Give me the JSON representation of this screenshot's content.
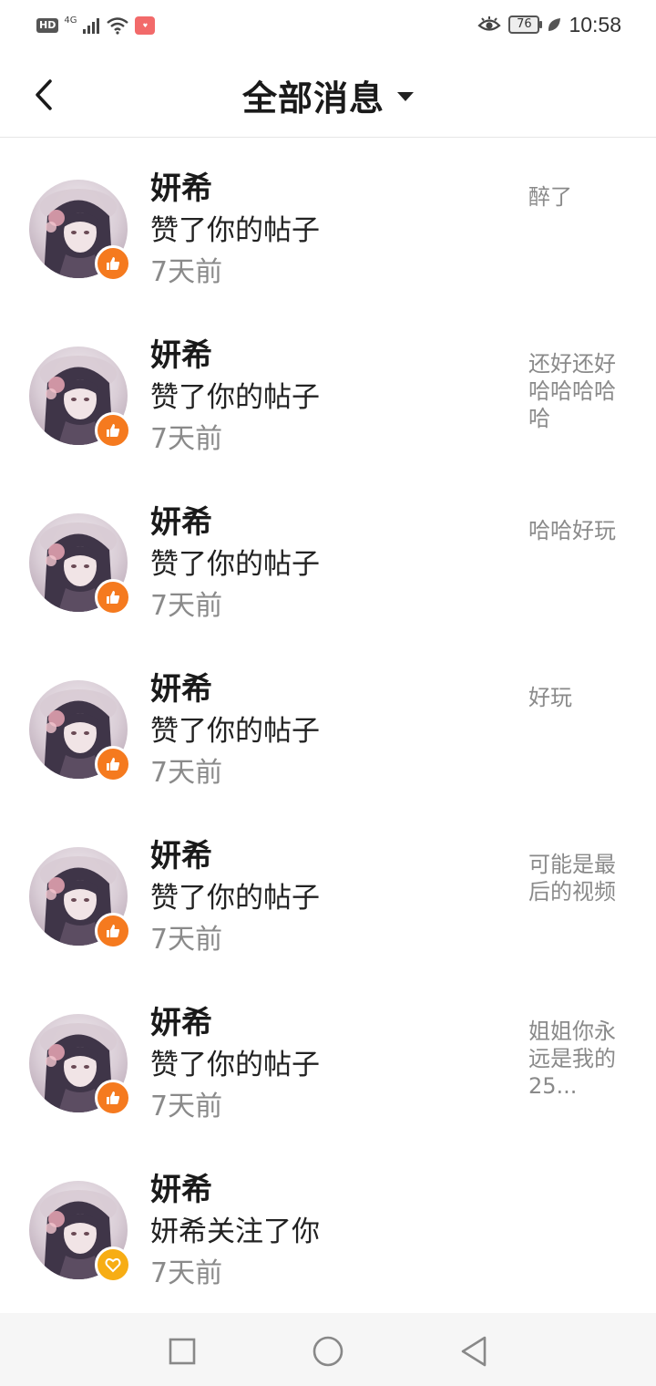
{
  "status_bar": {
    "hd": "HD",
    "network": "4G",
    "battery": "76",
    "time": "10:58"
  },
  "header": {
    "title": "全部消息"
  },
  "messages": [
    {
      "name": "妍希",
      "action": "赞了你的帖子",
      "time": "7天前",
      "snippet": "醉了",
      "badge": "thumb-up-icon"
    },
    {
      "name": "妍希",
      "action": "赞了你的帖子",
      "time": "7天前",
      "snippet": "还好还好哈哈哈哈哈",
      "badge": "thumb-up-icon"
    },
    {
      "name": "妍希",
      "action": "赞了你的帖子",
      "time": "7天前",
      "snippet": "哈哈好玩",
      "badge": "thumb-up-icon"
    },
    {
      "name": "妍希",
      "action": "赞了你的帖子",
      "time": "7天前",
      "snippet": "好玩",
      "badge": "thumb-up-icon"
    },
    {
      "name": "妍希",
      "action": "赞了你的帖子",
      "time": "7天前",
      "snippet": "可能是最后的视频",
      "badge": "thumb-up-icon"
    },
    {
      "name": "妍希",
      "action": "赞了你的帖子",
      "time": "7天前",
      "snippet": "姐姐你永远是我的25...",
      "badge": "thumb-up-icon"
    },
    {
      "name": "妍希",
      "action": "妍希关注了你",
      "time": "7天前",
      "snippet": "",
      "badge": "heart-icon"
    }
  ],
  "colors": {
    "like_badge": "#f57a1f",
    "follow_badge": "#f7ad14"
  }
}
